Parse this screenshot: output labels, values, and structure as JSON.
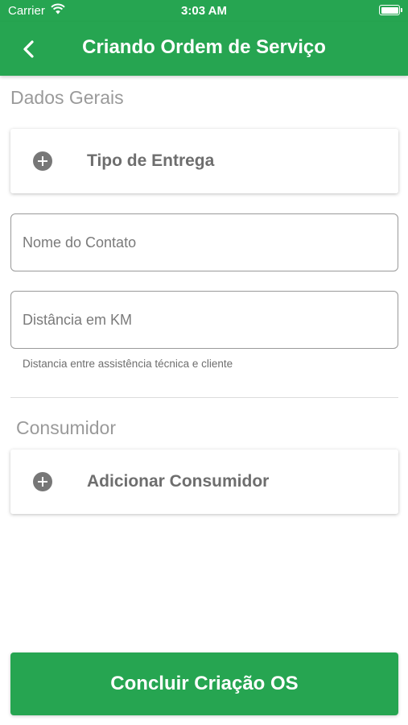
{
  "status_bar": {
    "carrier": "Carrier",
    "time": "3:03 AM",
    "icons": [
      "wifi-icon",
      "battery-icon"
    ]
  },
  "nav": {
    "title": "Criando Ordem de Serviço",
    "back_icon": "chevron-left-icon"
  },
  "general": {
    "section_title": "Dados Gerais",
    "delivery_type_label": "Tipo de Entrega",
    "contact_name_placeholder": "Nome do Contato",
    "distance_placeholder": "Distância em KM",
    "distance_helper": "Distancia entre assistência técnica e cliente"
  },
  "consumer": {
    "section_title": "Consumidor",
    "add_consumer_label": "Adicionar Consumidor"
  },
  "actions": {
    "submit_label": "Concluir Criação OS"
  },
  "colors": {
    "brand_green": "#26a551",
    "label_gray": "#9a9a9a",
    "text_gray": "#6e6e6e"
  }
}
